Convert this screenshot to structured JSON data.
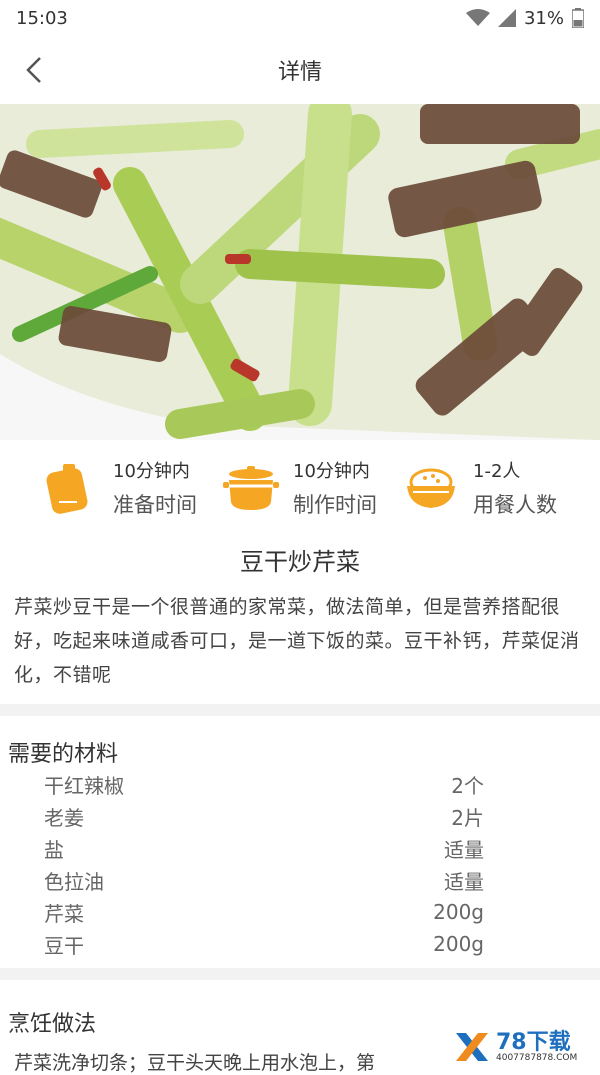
{
  "status": {
    "time": "15:03",
    "battery": "31%"
  },
  "nav": {
    "title": "详情"
  },
  "stats": [
    {
      "value": "10分钟内",
      "label": "准备时间",
      "icon": "prep-time-icon"
    },
    {
      "value": "10分钟内",
      "label": "制作时间",
      "icon": "cooking-pot-icon"
    },
    {
      "value": "1-2人",
      "label": "用餐人数",
      "icon": "rice-bowl-icon"
    }
  ],
  "dish": {
    "title": "豆干炒芹菜",
    "description": "芹菜炒豆干是一个很普通的家常菜，做法简单，但是营养搭配很好，吃起来味道咸香可口，是一道下饭的菜。豆干补钙，芹菜促消化，不错呢"
  },
  "ingredients": {
    "title": "需要的材料",
    "items": [
      {
        "name": "干红辣椒",
        "amount": "2个"
      },
      {
        "name": "老姜",
        "amount": "2片"
      },
      {
        "name": "盐",
        "amount": "适量"
      },
      {
        "name": "色拉油",
        "amount": "适量"
      },
      {
        "name": "芹菜",
        "amount": "200g"
      },
      {
        "name": "豆干",
        "amount": "200g"
      }
    ]
  },
  "steps": {
    "title": "烹饪做法",
    "first_step": "芹菜洗净切条；豆干头天晚上用水泡上，第"
  },
  "watermark": {
    "brand": "78下载",
    "site": "4007787878.COM"
  },
  "colors": {
    "accent": "#f5a623",
    "divider": "#f2f2f2"
  }
}
